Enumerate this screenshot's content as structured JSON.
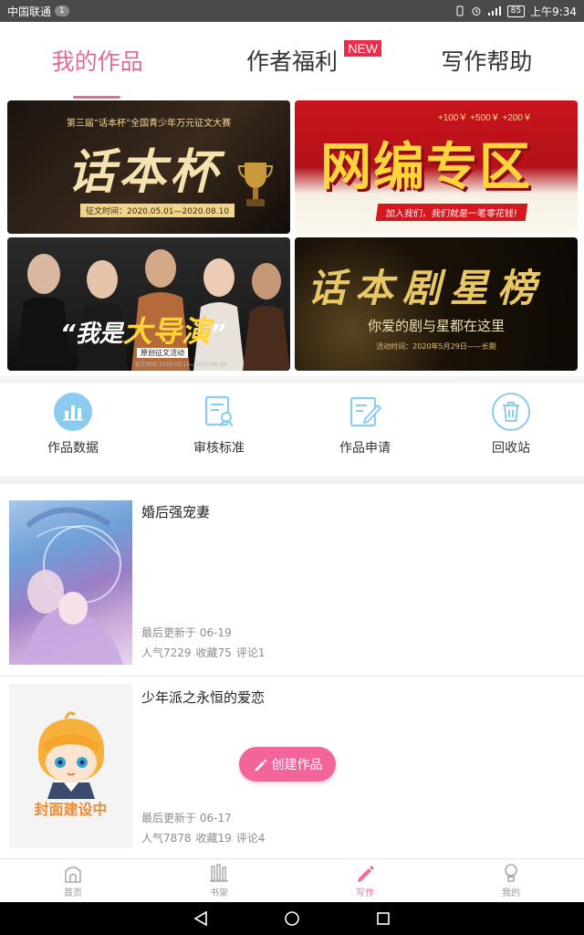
{
  "status_bar": {
    "carrier": "中国联通",
    "notification_count": "1",
    "battery": "85",
    "time": "上午9:34"
  },
  "top_tabs": {
    "items": [
      {
        "label": "我的作品",
        "active": true
      },
      {
        "label": "作者福利",
        "active": false
      },
      {
        "label": "写作帮助",
        "active": false
      }
    ],
    "new_badge": "NEW"
  },
  "banners": {
    "b1": {
      "top_line": "第三届“话本杯”全国青少年万元征文大赛",
      "title": "话本杯",
      "date": "征文时间：2020.05.01—2020.08.10"
    },
    "b2": {
      "money": "+100￥  +500￥  +200￥",
      "title": "网编专区",
      "ribbon": "加入我们，我们就是一笔零花钱!"
    },
    "b3": {
      "title_prefix": "“我是",
      "title_highlight": "大导演",
      "title_suffix": "”",
      "sub": "原创征文活动",
      "tiny": "征文时间 2020.05.15—2020.06.30"
    },
    "b4": {
      "title": "话本剧星榜",
      "sub": "你爱的剧与星都在这里",
      "tiny": "活动时间：2020年5月29日——长期"
    }
  },
  "functions": {
    "items": [
      {
        "label": "作品数据",
        "icon": "bar-chart-icon"
      },
      {
        "label": "审核标准",
        "icon": "review-doc-icon"
      },
      {
        "label": "作品申请",
        "icon": "edit-doc-icon"
      },
      {
        "label": "回收站",
        "icon": "trash-icon"
      }
    ]
  },
  "works": [
    {
      "title": "婚后强宠妻",
      "updated": "最后更新于 06-19",
      "popularity": "人气7229",
      "favorites": "收藏75",
      "comments": "评论1"
    },
    {
      "title": "少年派之永恒的爱恋",
      "updated": "最后更新于 06-17",
      "popularity": "人气7878",
      "favorites": "收藏19",
      "comments": "评论4",
      "cover_text": "封面建设中"
    }
  ],
  "create_button": {
    "label": "创建作品",
    "color": "#f3649a"
  },
  "bottom_nav": {
    "items": [
      {
        "label": "首页",
        "icon": "home-icon"
      },
      {
        "label": "书架",
        "icon": "bookshelf-icon"
      },
      {
        "label": "写作",
        "icon": "pen-icon",
        "active": true
      },
      {
        "label": "我的",
        "icon": "profile-icon"
      }
    ]
  },
  "colors": {
    "accent_pink": "#e86a92",
    "icon_blue": "#8ccbf0",
    "new_badge_red": "#ee2b47"
  }
}
